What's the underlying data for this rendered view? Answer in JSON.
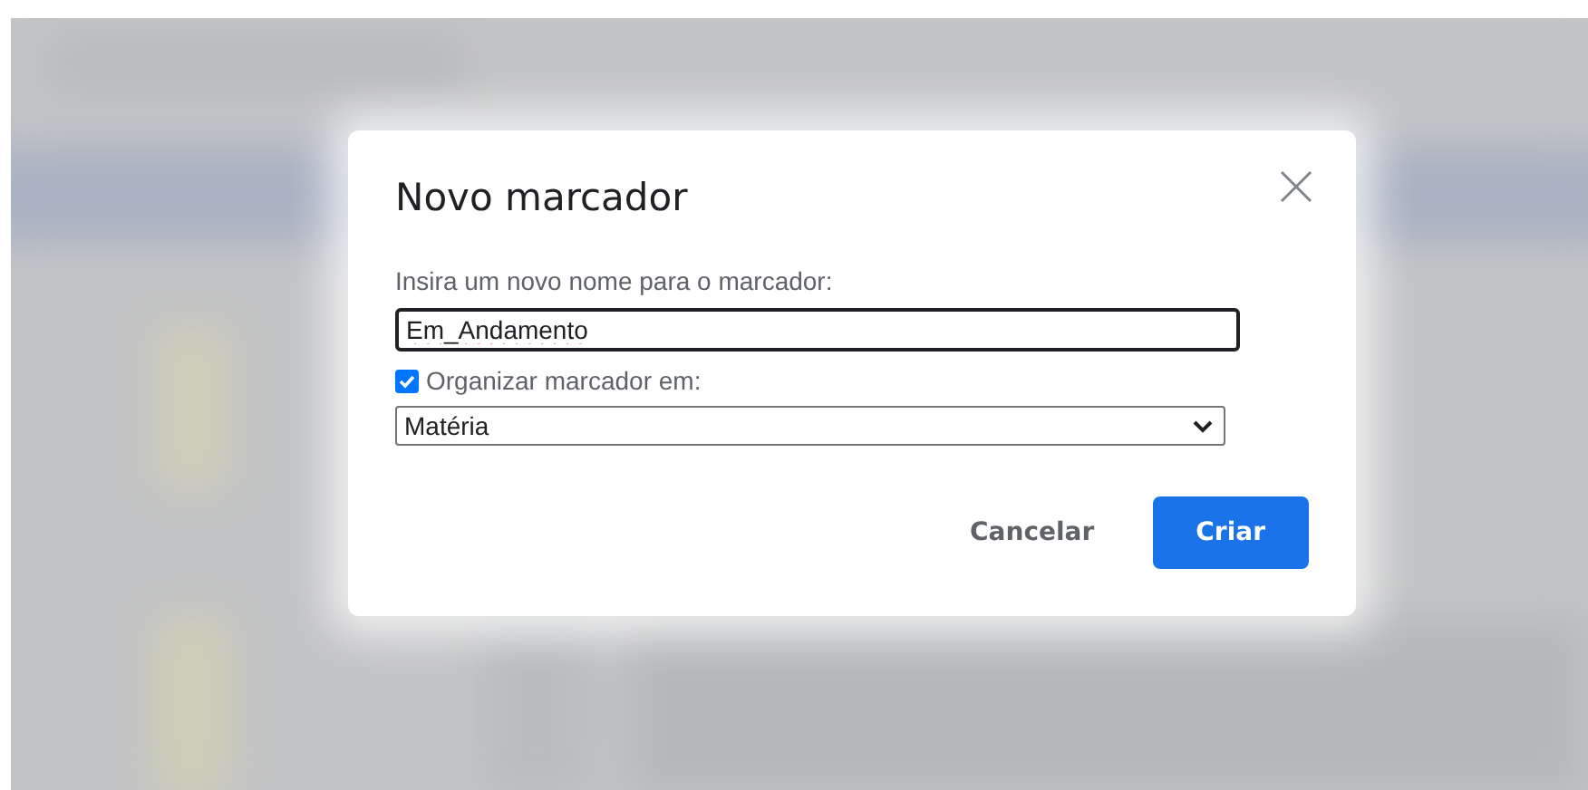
{
  "dialog": {
    "title": "Novo marcador",
    "name_label": "Insira um novo nome para o marcador:",
    "name_field": {
      "value": "Em_Andamento",
      "focused": true
    },
    "nest_option": {
      "label": "Organizar marcador em:",
      "checked": true
    },
    "parent_select": {
      "value": "Matéria"
    },
    "buttons": [
      {
        "label": "Cancelar",
        "kind": "text"
      },
      {
        "label": "Criar",
        "kind": "primary"
      }
    ]
  }
}
